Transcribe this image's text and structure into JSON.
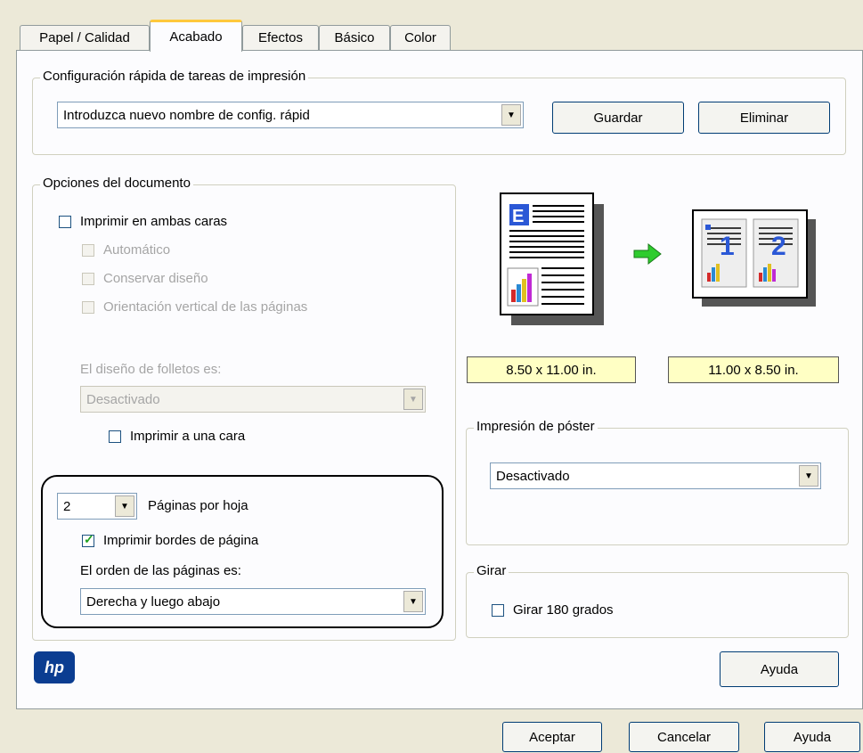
{
  "tabs": [
    "Papel / Calidad",
    "Acabado",
    "Efectos",
    "Básico",
    "Color"
  ],
  "quick_config": {
    "legend": "Configuración rápida de tareas de impresión",
    "name_value": "Introduzca nuevo nombre de config. rápid",
    "save_label": "Guardar",
    "delete_label": "Eliminar"
  },
  "doc_options": {
    "legend": "Opciones del documento",
    "print_both_sides": "Imprimir en ambas caras",
    "automatic": "Automático",
    "keep_layout": "Conservar diseño",
    "portrait_pages": "Orientación vertical de las páginas",
    "booklet_label": "El diseño de folletos es:",
    "booklet_value": "Desactivado",
    "print_one_side": "Imprimir a una cara",
    "pages_per_sheet_value": "2",
    "pages_per_sheet_label": "Páginas por hoja",
    "print_borders": "Imprimir bordes de página",
    "print_borders_checked": true,
    "page_order_label": "El orden de las páginas es:",
    "page_order_value": "Derecha y luego abajo"
  },
  "preview": {
    "source_size": "8.50 x 11.00 in.",
    "target_size": "11.00 x 8.50 in."
  },
  "poster": {
    "legend": "Impresión de póster",
    "value": "Desactivado"
  },
  "rotate": {
    "legend": "Girar",
    "rotate_180": "Girar 180 grados"
  },
  "logo_text": "hp",
  "help_label": "Ayuda",
  "footer": {
    "ok": "Aceptar",
    "cancel": "Cancelar",
    "help": "Ayuda"
  }
}
